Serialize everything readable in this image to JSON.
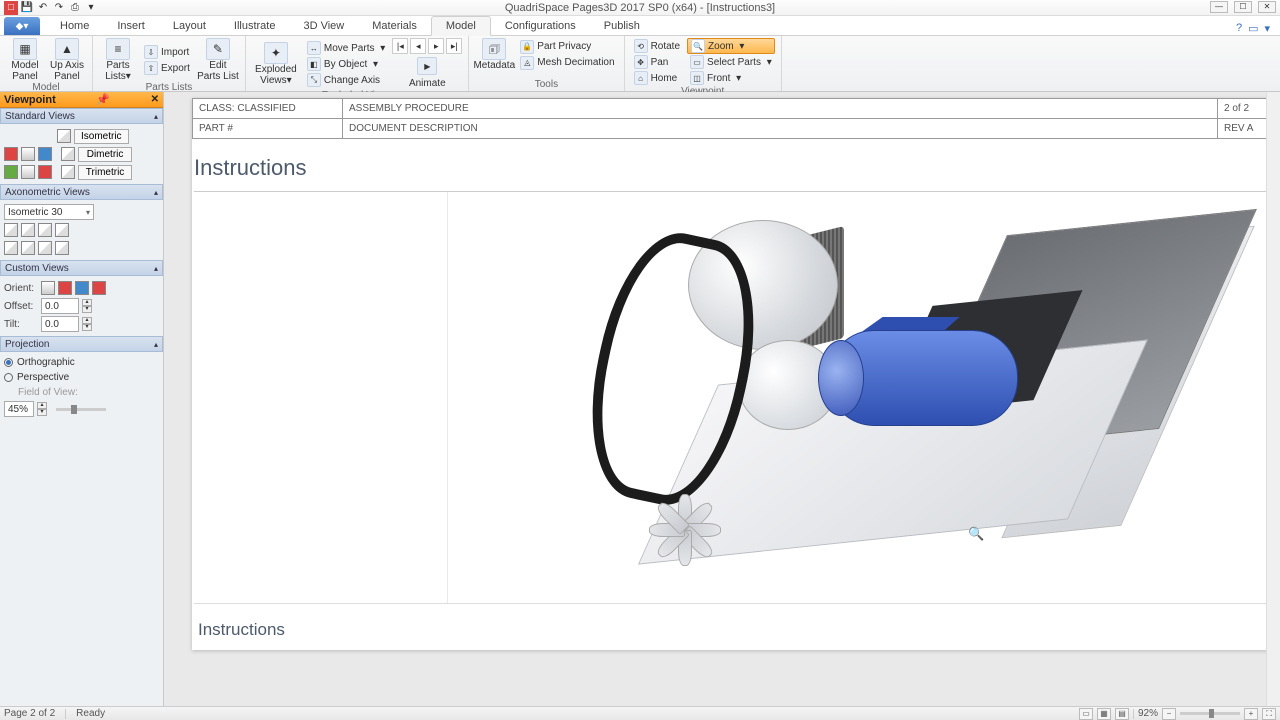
{
  "app": {
    "title": "QuadriSpace Pages3D  2017 SP0 (x64) - [Instructions3]"
  },
  "qat": [
    "□",
    "▤",
    "↶",
    "↷",
    "▦",
    "▾"
  ],
  "tabs": {
    "items": [
      "Home",
      "Insert",
      "Layout",
      "Illustrate",
      "3D View",
      "Materials",
      "Model",
      "Configurations",
      "Publish"
    ],
    "active": "Model"
  },
  "ribbon": {
    "model": {
      "label": "Model",
      "model_panel": "Model Panel",
      "up_axis": "Up Axis Panel",
      "parts_lists": "Parts Lists▾",
      "parts_lists_label": "Parts Lists",
      "import": "Import",
      "export": "Export",
      "edit_parts": "Edit Parts List"
    },
    "exploded": {
      "label": "Exploded Views",
      "exploded_views": "Exploded Views▾",
      "move_parts": "Move Parts",
      "by_object": "By Object",
      "change_axis": "Change Axis",
      "animate": "Animate"
    },
    "tools": {
      "label": "Tools",
      "metadata": "Metadata",
      "part_privacy": "Part Privacy",
      "mesh": "Mesh Decimation"
    },
    "viewpoint": {
      "label": "Viewpoint",
      "rotate": "Rotate",
      "pan": "Pan",
      "home": "Home",
      "zoom": "Zoom",
      "select_parts": "Select Parts",
      "front": "Front"
    }
  },
  "sidepanel": {
    "title": "Viewpoint",
    "standard": {
      "label": "Standard Views",
      "isometric": "Isometric",
      "dimetric": "Dimetric",
      "trimetric": "Trimetric"
    },
    "axon": {
      "label": "Axonometric Views",
      "selected": "Isometric 30"
    },
    "custom": {
      "label": "Custom Views",
      "orient": "Orient:",
      "offset": "Offset:",
      "offset_val": "0.0",
      "tilt": "Tilt:",
      "tilt_val": "0.0"
    },
    "projection": {
      "label": "Projection",
      "ortho": "Orthographic",
      "persp": "Perspective",
      "fov": "Field of View:",
      "fov_val": "45%"
    }
  },
  "page": {
    "header": {
      "class": "CLASS: CLASSIFIED",
      "title": "ASSEMBLY PROCEDURE",
      "page": "2 of 2",
      "part": "PART #",
      "docdesc": "DOCUMENT DESCRIPTION",
      "rev": "REV A"
    },
    "section_title": "Instructions",
    "footer_title": "Instructions"
  },
  "status": {
    "page": "Page 2 of 2",
    "state": "Ready",
    "zoom": "92%"
  }
}
